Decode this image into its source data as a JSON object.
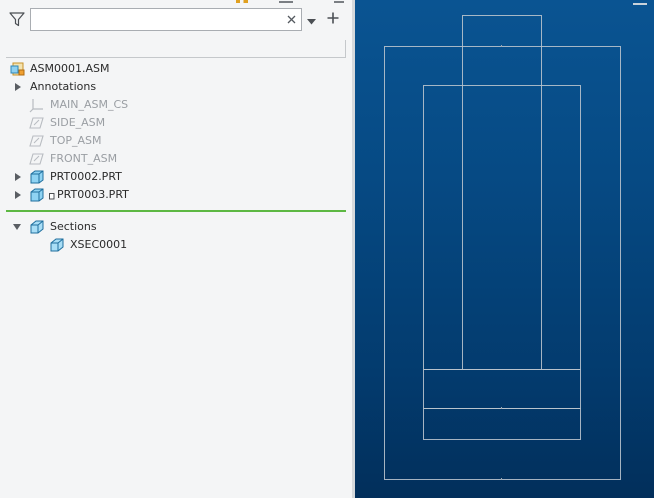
{
  "search": {
    "placeholder": "",
    "value": ""
  },
  "tree": {
    "root": {
      "label": "ASM0001.ASM",
      "icon": "assembly-icon"
    },
    "items": [
      {
        "label": "Annotations",
        "icon": "",
        "expandable": true,
        "dim": false
      },
      {
        "label": "MAIN_ASM_CS",
        "icon": "coordinate-system-icon",
        "expandable": false,
        "dim": true
      },
      {
        "label": "SIDE_ASM",
        "icon": "datum-plane-icon",
        "expandable": false,
        "dim": true
      },
      {
        "label": "TOP_ASM",
        "icon": "datum-plane-icon",
        "expandable": false,
        "dim": true
      },
      {
        "label": "FRONT_ASM",
        "icon": "datum-plane-icon",
        "expandable": false,
        "dim": true
      },
      {
        "label": "PRT0002.PRT",
        "icon": "part-icon",
        "expandable": true,
        "dim": false
      },
      {
        "label": "PRT0003.PRT",
        "icon": "part-icon",
        "expandable": true,
        "dim": false
      }
    ],
    "sections": {
      "label": "Sections",
      "icon": "section-icon",
      "children": [
        {
          "label": "XSEC0001",
          "icon": "section-icon"
        }
      ]
    }
  },
  "colors": {
    "separator": "#5db843",
    "viewport_top": "#0a5492",
    "viewport_bottom": "#022f5b",
    "wireframe": "#b9c3cc"
  }
}
